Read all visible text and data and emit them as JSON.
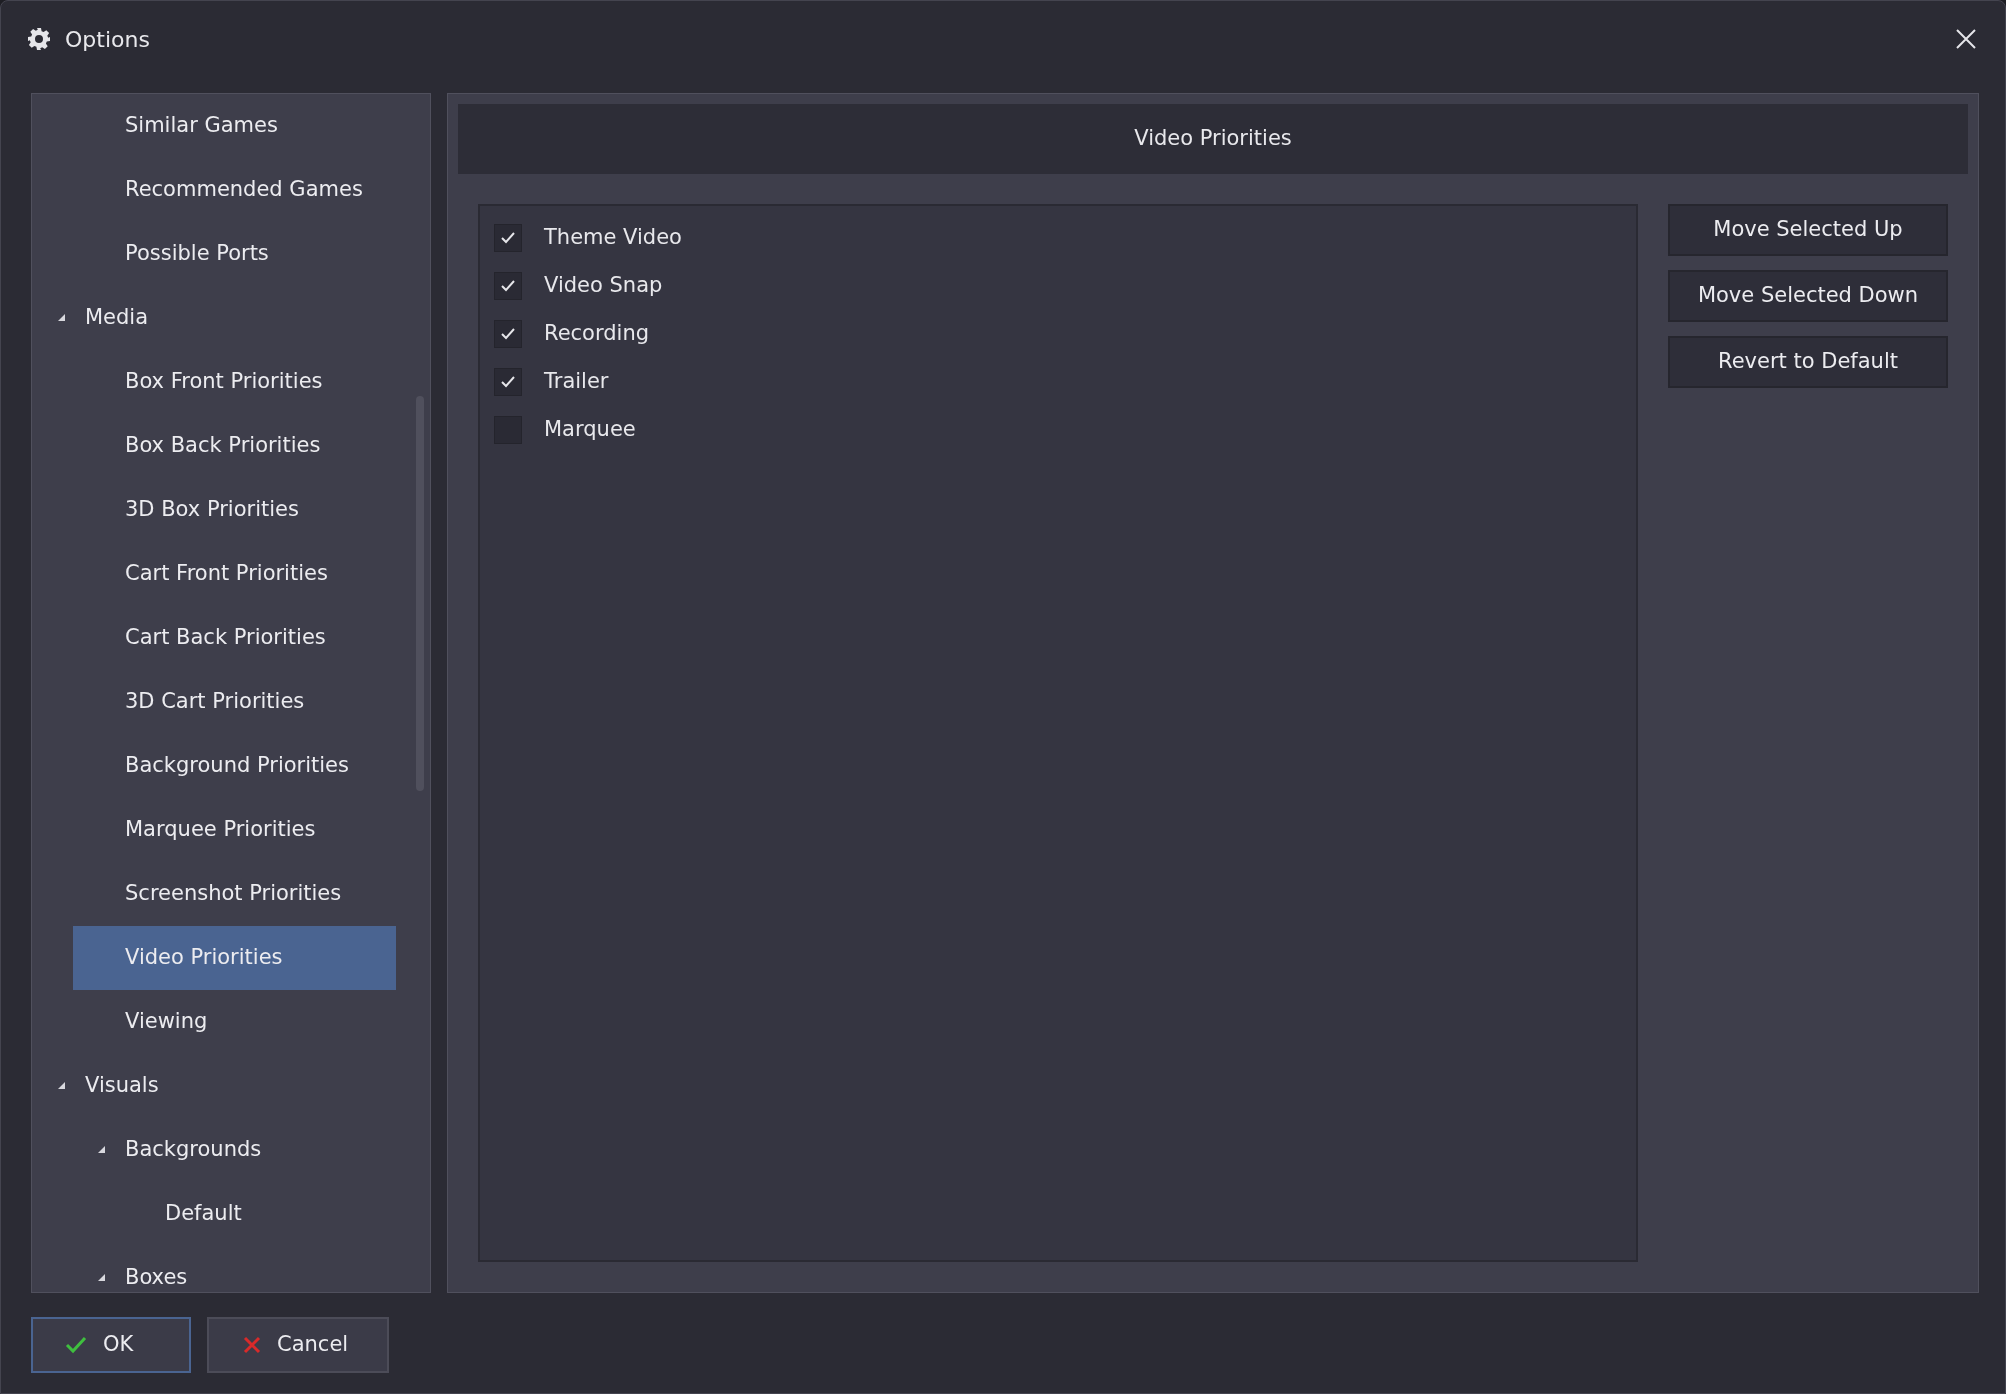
{
  "window": {
    "title": "Options"
  },
  "tree": {
    "items": [
      {
        "children": [
          {
            "label": "Similar Games",
            "selected": false
          },
          {
            "label": "Recommended Games",
            "selected": false
          },
          {
            "label": "Possible Ports",
            "selected": false
          }
        ]
      },
      {
        "label": "Media",
        "expanded": true,
        "selected": false,
        "children": [
          {
            "label": "Box Front Priorities",
            "selected": false
          },
          {
            "label": "Box Back Priorities",
            "selected": false
          },
          {
            "label": "3D Box Priorities",
            "selected": false
          },
          {
            "label": "Cart Front Priorities",
            "selected": false
          },
          {
            "label": "Cart Back Priorities",
            "selected": false
          },
          {
            "label": "3D Cart Priorities",
            "selected": false
          },
          {
            "label": "Background Priorities",
            "selected": false
          },
          {
            "label": "Marquee Priorities",
            "selected": false
          },
          {
            "label": "Screenshot Priorities",
            "selected": false
          },
          {
            "label": "Video Priorities",
            "selected": true
          },
          {
            "label": "Viewing",
            "selected": false
          }
        ]
      },
      {
        "label": "Visuals",
        "expanded": true,
        "selected": false,
        "children": [
          {
            "label": "Backgrounds",
            "expanded": true,
            "selected": false,
            "children": [
              {
                "label": "Default",
                "selected": false
              }
            ]
          },
          {
            "label": "Boxes",
            "expanded": true,
            "selected": false
          }
        ]
      }
    ]
  },
  "panel": {
    "title": "Video Priorities",
    "items": [
      {
        "label": "Theme Video",
        "checked": true
      },
      {
        "label": "Video Snap",
        "checked": true
      },
      {
        "label": "Recording",
        "checked": true
      },
      {
        "label": "Trailer",
        "checked": true
      },
      {
        "label": "Marquee",
        "checked": false
      }
    ],
    "buttons": [
      "Move Selected Up",
      "Move Selected Down",
      "Revert to Default"
    ]
  },
  "footer": {
    "buttons": [
      {
        "label": "OK",
        "kind": "ok"
      },
      {
        "label": "Cancel",
        "kind": "cancel"
      }
    ]
  }
}
